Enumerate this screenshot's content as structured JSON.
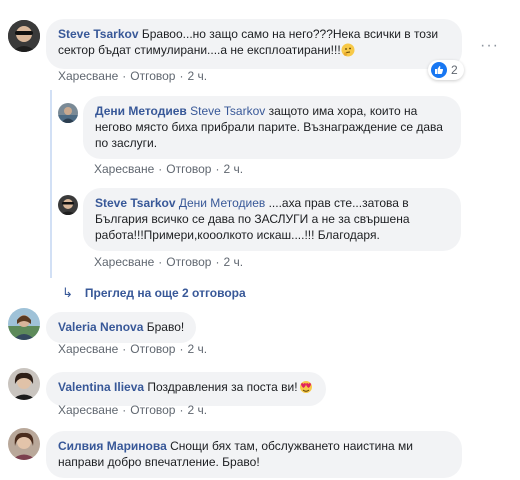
{
  "actions": {
    "like": "Харесване",
    "reply": "Отговор"
  },
  "comments": [
    {
      "author": "Steve Tsarkov",
      "text": "Бравоо...но защо само на него???Нека всички в този сектор бъдат стимулирани....а не експлоатирани!!!",
      "time": "2 ч.",
      "reaction_count": "2"
    },
    {
      "author": "Дени Методиев",
      "mention": "Steve Tsarkov",
      "text": "защото има хора, които на негово място биха прибрали парите. Възнаграждение се дава по заслуги.",
      "time": "2 ч."
    },
    {
      "author": "Steve Tsarkov",
      "mention": "Дени Методиев",
      "text": "....аха прав сте...затова в България всичко се дава по ЗАСЛУГИ а не за свършена работа!!!Примери,кооолкото искаш....!!! Благодаря.",
      "time": "2 ч."
    },
    {
      "author": "Valeria Nenova",
      "text": "Браво!",
      "time": "2 ч."
    },
    {
      "author": "Valentina Ilieva",
      "text": "Поздравления за поста ви!",
      "time": "2 ч."
    },
    {
      "author": "Силвия Маринова",
      "text": "Снощи бях там, обслужването наистина ми направи добро впечатление. Браво!"
    }
  ],
  "more_replies": "Преглед на още 2 отговора",
  "colors": {
    "link": "#385898",
    "bubble": "#f2f3f5",
    "muted": "#606770",
    "like_blue": "#1877f2"
  }
}
